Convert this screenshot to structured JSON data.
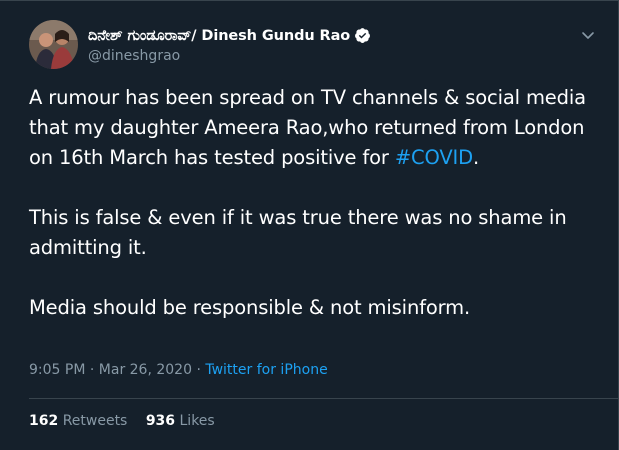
{
  "tweet": {
    "author": {
      "display_name": "ದಿನೇಶ್ ಗುಂಡೂರಾವ್/ Dinesh Gundu Rao",
      "handle": "@dineshgrao",
      "verified": true
    },
    "text": {
      "para1_pre": "A rumour has been spread on TV channels & social media that my daughter Ameera Rao,who returned from London on 16th March has tested positive for ",
      "hashtag": "#COVID",
      "para1_post": ".",
      "para2": "This is false & even if it was true there was no shame in admitting it.",
      "para3": "Media should be responsible & not misinform."
    },
    "meta": {
      "time": "9:05 PM",
      "separator": "·",
      "date": "Mar 26, 2020",
      "source": "Twitter for iPhone"
    },
    "stats": {
      "retweets_count": "162",
      "retweets_label": "Retweets",
      "likes_count": "936",
      "likes_label": "Likes"
    }
  },
  "colors": {
    "background": "#15202b",
    "primary_text": "#ffffff",
    "secondary_text": "#8899a6",
    "accent": "#1da1f2",
    "border": "#38444d"
  },
  "icons": {
    "avatar": "profile-photo",
    "verified": "verified-badge-icon",
    "menu": "chevron-down-icon"
  }
}
